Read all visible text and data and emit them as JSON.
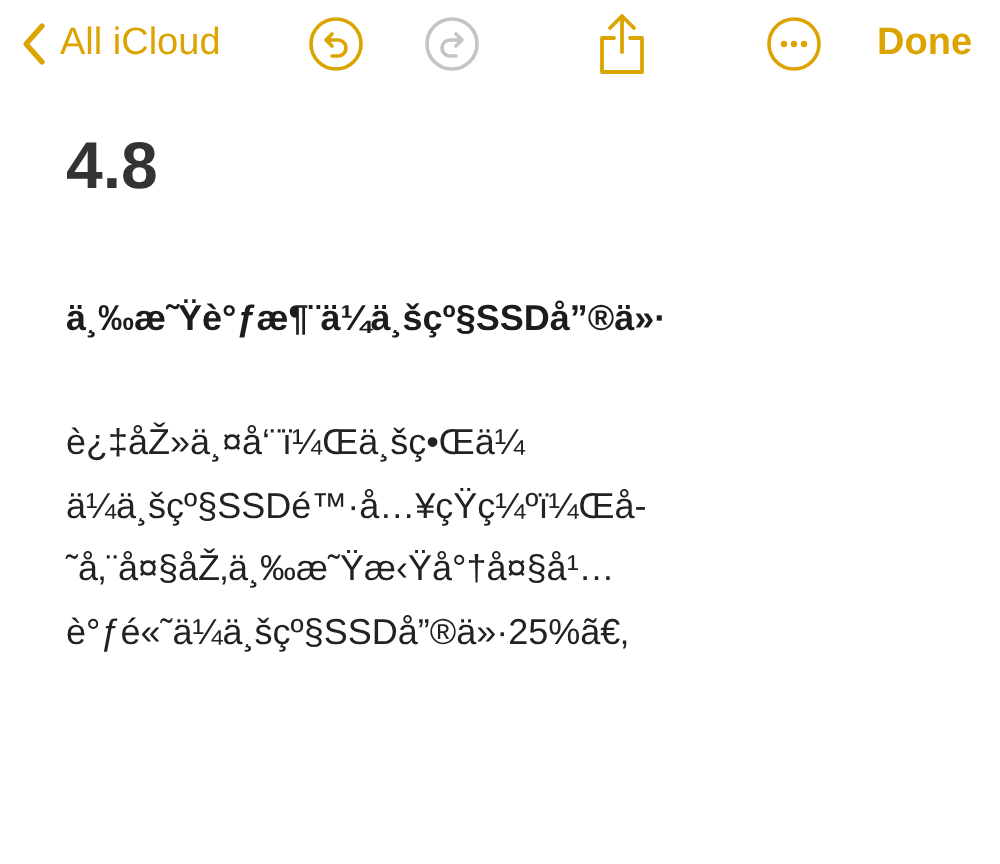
{
  "nav": {
    "back_label": "All iCloud",
    "undo_disabled": false,
    "redo_disabled": true,
    "done_label": "Done"
  },
  "note": {
    "title": "4.8",
    "heading": "ä¸‰æ˜Ÿè°ƒæ¶¨ä¼ä¸šçº§SSDå”®ä»·",
    "body_lines": [
      "è¿‡åŽ»ä¸¤å‘¨ï¼Œä¸šç•Œä¼",
      "ä¼ä¸šçº§SSDé™·å…¥çŸç¼ºï¼Œå-",
      "˜å‚¨å¤§åŽ‚ä¸‰æ˜Ÿæ‹Ÿå°†å¤§å¹…",
      "è°ƒé«˜ä¼ä¸šçº§SSDå”®ä»·25%ã€‚"
    ]
  }
}
